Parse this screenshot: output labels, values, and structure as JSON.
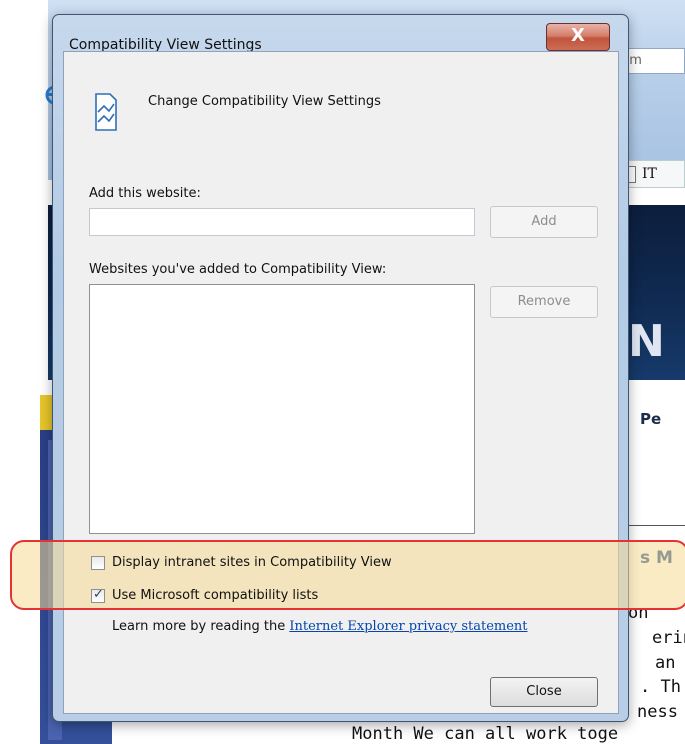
{
  "background": {
    "address_fragment": "hom",
    "tab_label": "IT",
    "page_fragment_big": "N",
    "page_fragment_pe": "Pe",
    "page_fragment_heading": "s M",
    "page_text_lines": [
      "on",
      "erin",
      "an",
      ". Th",
      "ness",
      "Month  We can all work toge"
    ]
  },
  "dialog": {
    "title": "Compatibility View Settings",
    "close_glyph": "X",
    "header": "Change Compatibility View Settings",
    "add_website_label": "Add this website:",
    "add_website_value": "",
    "add_button": "Add",
    "list_label": "Websites you've added to Compatibility View:",
    "added_sites": [],
    "remove_button": "Remove",
    "option_intranet": {
      "label": "Display intranet sites in Compatibility View",
      "checked": false
    },
    "option_ms_lists": {
      "label": "Use Microsoft compatibility lists",
      "checked": true
    },
    "learn_more_prefix": "Learn more by reading the",
    "privacy_link": "Internet Explorer privacy statement",
    "close_button": "Close"
  },
  "colors": {
    "highlight_border": "#e53333",
    "highlight_fill": "#f5db96",
    "link": "#0645ad"
  }
}
